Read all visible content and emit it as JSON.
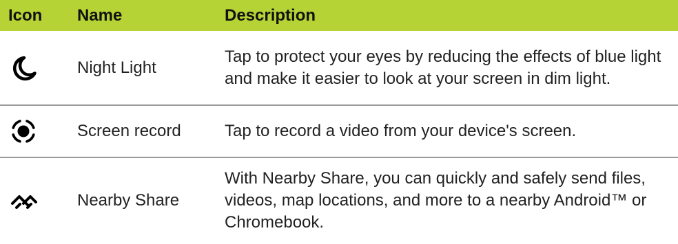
{
  "table": {
    "headers": {
      "icon": "Icon",
      "name": "Name",
      "description": "Description"
    },
    "rows": [
      {
        "icon": "night-light-moon-icon",
        "name": "Night Light",
        "description": "Tap to protect your eyes by reducing the effects of blue light and make it easier to look at your screen in dim light."
      },
      {
        "icon": "screen-record-icon",
        "name": "Screen record",
        "description": "Tap to record a video from your device's screen."
      },
      {
        "icon": "nearby-share-icon",
        "name": "Nearby Share",
        "description": "With Nearby Share, you can quickly and safely send files, videos, map locations, and more to a nearby Android™ or Chromebook."
      }
    ]
  },
  "colors": {
    "header_background": "#b5d334",
    "row_divider": "#9a9a9a"
  }
}
